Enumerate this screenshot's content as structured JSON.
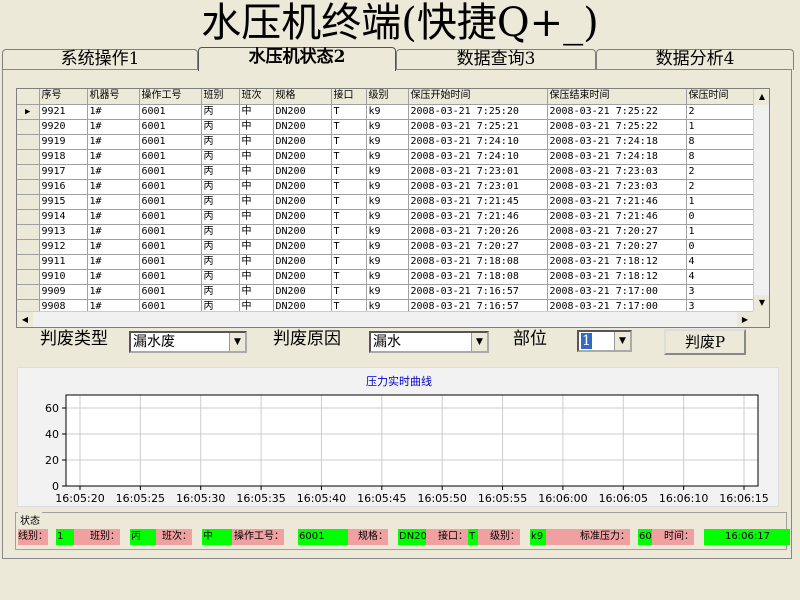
{
  "app": {
    "title": "水压机终端(快捷Q+_)"
  },
  "tabs": [
    {
      "label": "系统操作1"
    },
    {
      "label": "水压机状态2"
    },
    {
      "label": "数据查询3"
    },
    {
      "label": "数据分析4"
    }
  ],
  "grid": {
    "columns": [
      "序号",
      "机器号",
      "操作工号",
      "班别",
      "班次",
      "规格",
      "接口",
      "级别",
      "保压开始时间",
      "保压结束时间",
      "保压时间"
    ],
    "rows": [
      [
        "9921",
        "1#",
        "6001",
        "丙",
        "中",
        "DN200",
        "T",
        "k9",
        "2008-03-21  7:25:20",
        "2008-03-21  7:25:22",
        "2"
      ],
      [
        "9920",
        "1#",
        "6001",
        "丙",
        "中",
        "DN200",
        "T",
        "k9",
        "2008-03-21  7:25:21",
        "2008-03-21  7:25:22",
        "1"
      ],
      [
        "9919",
        "1#",
        "6001",
        "丙",
        "中",
        "DN200",
        "T",
        "k9",
        "2008-03-21  7:24:10",
        "2008-03-21  7:24:18",
        "8"
      ],
      [
        "9918",
        "1#",
        "6001",
        "丙",
        "中",
        "DN200",
        "T",
        "k9",
        "2008-03-21  7:24:10",
        "2008-03-21  7:24:18",
        "8"
      ],
      [
        "9917",
        "1#",
        "6001",
        "丙",
        "中",
        "DN200",
        "T",
        "k9",
        "2008-03-21  7:23:01",
        "2008-03-21  7:23:03",
        "2"
      ],
      [
        "9916",
        "1#",
        "6001",
        "丙",
        "中",
        "DN200",
        "T",
        "k9",
        "2008-03-21  7:23:01",
        "2008-03-21  7:23:03",
        "2"
      ],
      [
        "9915",
        "1#",
        "6001",
        "丙",
        "中",
        "DN200",
        "T",
        "k9",
        "2008-03-21  7:21:45",
        "2008-03-21  7:21:46",
        "1"
      ],
      [
        "9914",
        "1#",
        "6001",
        "丙",
        "中",
        "DN200",
        "T",
        "k9",
        "2008-03-21  7:21:46",
        "2008-03-21  7:21:46",
        "0"
      ],
      [
        "9913",
        "1#",
        "6001",
        "丙",
        "中",
        "DN200",
        "T",
        "k9",
        "2008-03-21  7:20:26",
        "2008-03-21  7:20:27",
        "1"
      ],
      [
        "9912",
        "1#",
        "6001",
        "丙",
        "中",
        "DN200",
        "T",
        "k9",
        "2008-03-21  7:20:27",
        "2008-03-21  7:20:27",
        "0"
      ],
      [
        "9911",
        "1#",
        "6001",
        "丙",
        "中",
        "DN200",
        "T",
        "k9",
        "2008-03-21  7:18:08",
        "2008-03-21  7:18:12",
        "4"
      ],
      [
        "9910",
        "1#",
        "6001",
        "丙",
        "中",
        "DN200",
        "T",
        "k9",
        "2008-03-21  7:18:08",
        "2008-03-21  7:18:12",
        "4"
      ],
      [
        "9909",
        "1#",
        "6001",
        "丙",
        "中",
        "DN200",
        "T",
        "k9",
        "2008-03-21  7:16:57",
        "2008-03-21  7:17:00",
        "3"
      ],
      [
        "9908",
        "1#",
        "6001",
        "丙",
        "中",
        "DN200",
        "T",
        "k9",
        "2008-03-21  7:16:57",
        "2008-03-21  7:17:00",
        "3"
      ]
    ]
  },
  "reject": {
    "type_label": "判废类型",
    "type_value": "漏水废",
    "reason_label": "判废原因",
    "reason_value": "漏水",
    "part_label": "部位",
    "part_value": "1",
    "button_label": "判废P"
  },
  "chart_data": {
    "type": "line",
    "title": "压力实时曲线",
    "x": [],
    "series": [],
    "xticks": [
      "16:05:20",
      "16:05:25",
      "16:05:30",
      "16:05:35",
      "16:05:40",
      "16:05:45",
      "16:05:50",
      "16:05:55",
      "16:06:00",
      "16:06:05",
      "16:06:10",
      "16:06:15"
    ],
    "yticks": [
      0,
      20,
      40,
      60
    ],
    "ylim": [
      0,
      70
    ],
    "grid": true
  },
  "status": {
    "title": "状态",
    "items": [
      {
        "label": "线别：",
        "value": "1"
      },
      {
        "label": "班别：",
        "value": "丙"
      },
      {
        "label": "班次：",
        "value": "中"
      },
      {
        "label": "操作工号：",
        "value": "6001"
      },
      {
        "label": "规格：",
        "value": "DN200"
      },
      {
        "label": "接口：",
        "value": "T"
      },
      {
        "label": "级别：",
        "value": "k9"
      },
      {
        "label": "标准压力：",
        "value": "60"
      },
      {
        "label": "时间：",
        "value": "16:06:17"
      }
    ]
  },
  "colors": {
    "status_value_bg": "#00ff00",
    "status_label_bg": "#f0a0a0",
    "title_color": "#0000cc"
  },
  "icons": {
    "scroll_up": "▲",
    "scroll_down": "▼",
    "scroll_left": "◀",
    "scroll_right": "▶",
    "dropdown": "▼"
  }
}
